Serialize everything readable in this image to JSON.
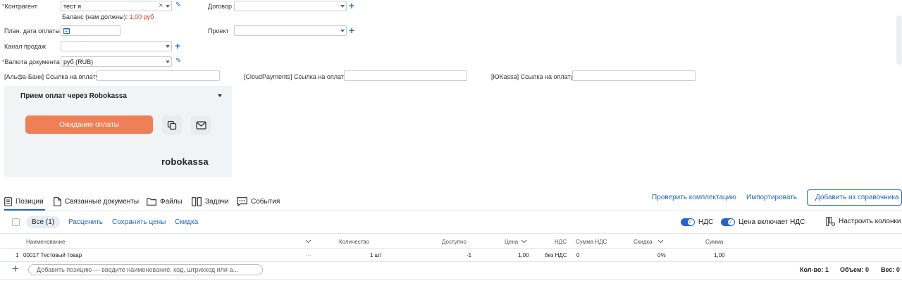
{
  "form": {
    "counterparty": {
      "label": "Контрагент",
      "value": "тест я",
      "clear": "×"
    },
    "balance": {
      "label": "Баланс (нам должны):",
      "value": "1,00 руб"
    },
    "contract": {
      "label": "Договор",
      "value": ""
    },
    "plan_date": {
      "label": "План. дата оплаты",
      "value": ""
    },
    "project": {
      "label": "Проект",
      "value": ""
    },
    "sales_channel": {
      "label": "Канал продаж",
      "value": ""
    },
    "currency": {
      "label": "Валюта документа",
      "value": "руб (RUB)"
    },
    "payment_links": [
      {
        "label": "[Альфа-Банк] Ссылка на оплату",
        "value": ""
      },
      {
        "label": "[CloudPayments] Ссылка на оплату",
        "value": ""
      },
      {
        "label": "[ЮKassa] Ссылка на оплату",
        "value": ""
      }
    ],
    "required_mark": "*"
  },
  "robokassa": {
    "title": "Прием оплат через Robokassa",
    "button": "Ожидание оплаты",
    "logo": "robokassa",
    "accent": "#ef7f57"
  },
  "tabs": [
    {
      "label": "Позиции",
      "icon": "document-list-icon"
    },
    {
      "label": "Связанные документы",
      "icon": "document-icon"
    },
    {
      "label": "Файлы",
      "icon": "folder-icon"
    },
    {
      "label": "Задачи",
      "icon": "tasks-icon"
    },
    {
      "label": "События",
      "icon": "events-icon"
    }
  ],
  "tab_actions": {
    "check": "Проверить комплектацию",
    "import": "Импортировать",
    "add": "Добавить из справочника"
  },
  "toolbar": {
    "all": "Все (1)",
    "reprice": "Расценить",
    "save_prices": "Сохранить цены",
    "discount": "Скидка",
    "vat": "НДС",
    "price_includes_vat": "Цена включает НДС",
    "columns": "Настроить колонки"
  },
  "table": {
    "headers": {
      "name": "Наименование",
      "qty": "Количество",
      "available": "Доступно",
      "price": "Цена",
      "vat": "НДС",
      "vat_sum": "Сумма НДС",
      "discount": "Скидка",
      "sum": "Сумма"
    },
    "rows": [
      {
        "num": "1",
        "name": "00017 Тестовый товар",
        "dots": "···",
        "qty": "1 шт",
        "available": "-1",
        "price": "1,00",
        "vat": "без НДС",
        "vat_sum": "0",
        "discount": "0%",
        "sum": "1,00"
      }
    ]
  },
  "footer": {
    "add_placeholder": "Добавить позицию — введите наименование, код, штрихкод или а...",
    "count": "Кол-во: 1",
    "volume": "Объем: 0",
    "weight": "Вес: 0"
  }
}
